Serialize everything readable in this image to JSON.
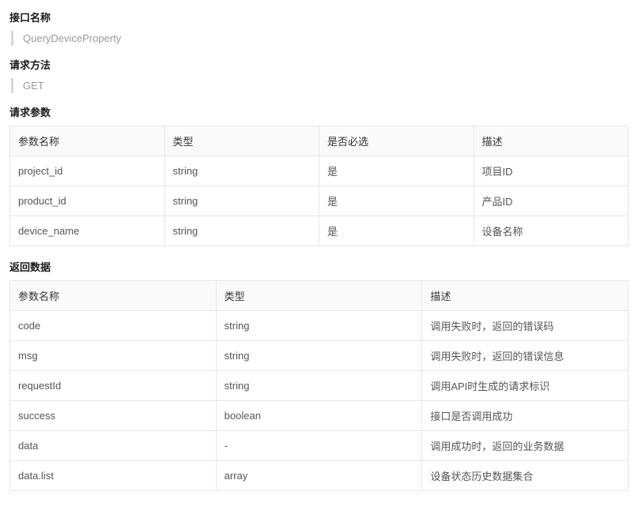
{
  "sections": {
    "api_name_label": "接口名称",
    "api_name_value": "QueryDeviceProperty",
    "method_label": "请求方法",
    "method_value": "GET",
    "req_params_label": "请求参数",
    "resp_data_label": "返回数据"
  },
  "req_table": {
    "headers": {
      "name": "参数名称",
      "type": "类型",
      "required": "是否必选",
      "desc": "描述"
    },
    "rows": [
      {
        "name": "project_id",
        "type": "string",
        "required": "是",
        "desc": "项目ID"
      },
      {
        "name": "product_id",
        "type": "string",
        "required": "是",
        "desc": "产品ID"
      },
      {
        "name": "device_name",
        "type": "string",
        "required": "是",
        "desc": "设备名称"
      }
    ]
  },
  "resp_table": {
    "headers": {
      "name": "参数名称",
      "type": "类型",
      "desc": "描述"
    },
    "rows": [
      {
        "name": "code",
        "type": "string",
        "desc": "调用失败时，返回的错误码"
      },
      {
        "name": "msg",
        "type": "string",
        "desc": "调用失败时，返回的错误信息"
      },
      {
        "name": "requestId",
        "type": "string",
        "desc": "调用API时生成的请求标识"
      },
      {
        "name": "success",
        "type": "boolean",
        "desc": "接口是否调用成功"
      },
      {
        "name": "data",
        "type": "-",
        "desc": "调用成功时，返回的业务数据"
      },
      {
        "name": "data.list",
        "type": "array",
        "desc": "设备状态历史数据集合"
      }
    ]
  }
}
